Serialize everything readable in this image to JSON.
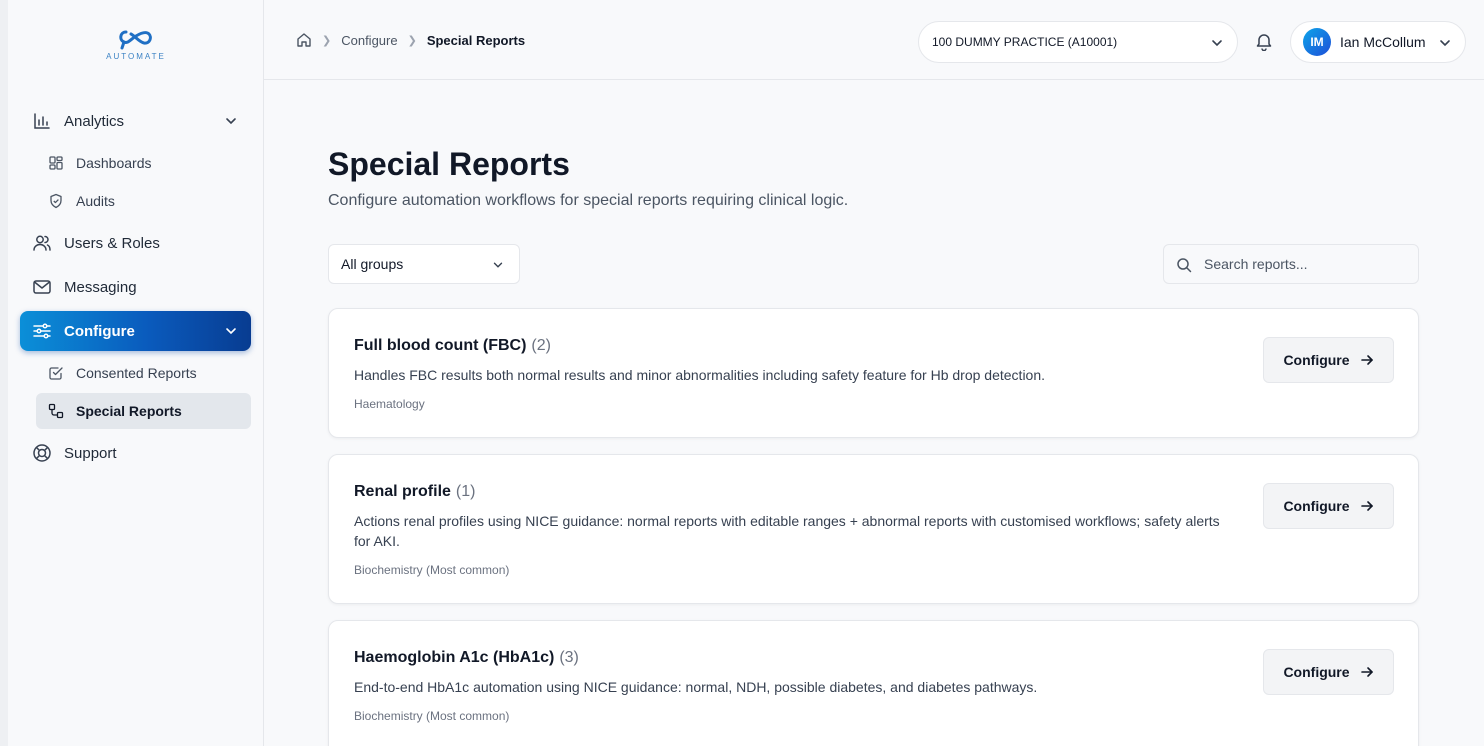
{
  "brand": {
    "logo_text": "AUTOMATE",
    "accent": "#0a5bbd"
  },
  "sidebar": {
    "items": [
      {
        "label": "Analytics",
        "icon": "bar-chart-icon"
      },
      {
        "label": "Dashboards",
        "icon": "grid-icon"
      },
      {
        "label": "Audits",
        "icon": "shield-icon"
      },
      {
        "label": "Users & Roles",
        "icon": "users-icon"
      },
      {
        "label": "Messaging",
        "icon": "mail-icon"
      },
      {
        "label": "Configure",
        "icon": "sliders-icon"
      },
      {
        "label": "Consented Reports",
        "icon": "checkbox-icon"
      },
      {
        "label": "Special Reports",
        "icon": "workflow-icon"
      },
      {
        "label": "Support",
        "icon": "lifebuoy-icon"
      }
    ]
  },
  "header": {
    "breadcrumb": [
      "Configure",
      "Special Reports"
    ],
    "practice": "100 DUMMY PRACTICE (A10001)",
    "user": {
      "initials": "IM",
      "name": "Ian McCollum"
    }
  },
  "page": {
    "title": "Special Reports",
    "subtitle": "Configure automation workflows for special reports requiring clinical logic.",
    "group_filter": "All groups",
    "search_placeholder": "Search reports..."
  },
  "reports": [
    {
      "title": "Full blood count (FBC)",
      "count": "(2)",
      "description": "Handles FBC results both normal results and minor abnormalities including safety feature for Hb drop detection.",
      "category": "Haematology",
      "button": "Configure"
    },
    {
      "title": "Renal profile",
      "count": "(1)",
      "description": "Actions renal profiles using NICE guidance: normal reports with editable ranges + abnormal reports with customised workflows; safety alerts for AKI.",
      "category": "Biochemistry (Most common)",
      "button": "Configure"
    },
    {
      "title": "Haemoglobin A1c (HbA1c)",
      "count": "(3)",
      "description": "End-to-end HbA1c automation using NICE guidance: normal, NDH, possible diabetes, and diabetes pathways.",
      "category": "Biochemistry (Most common)",
      "button": "Configure"
    }
  ]
}
